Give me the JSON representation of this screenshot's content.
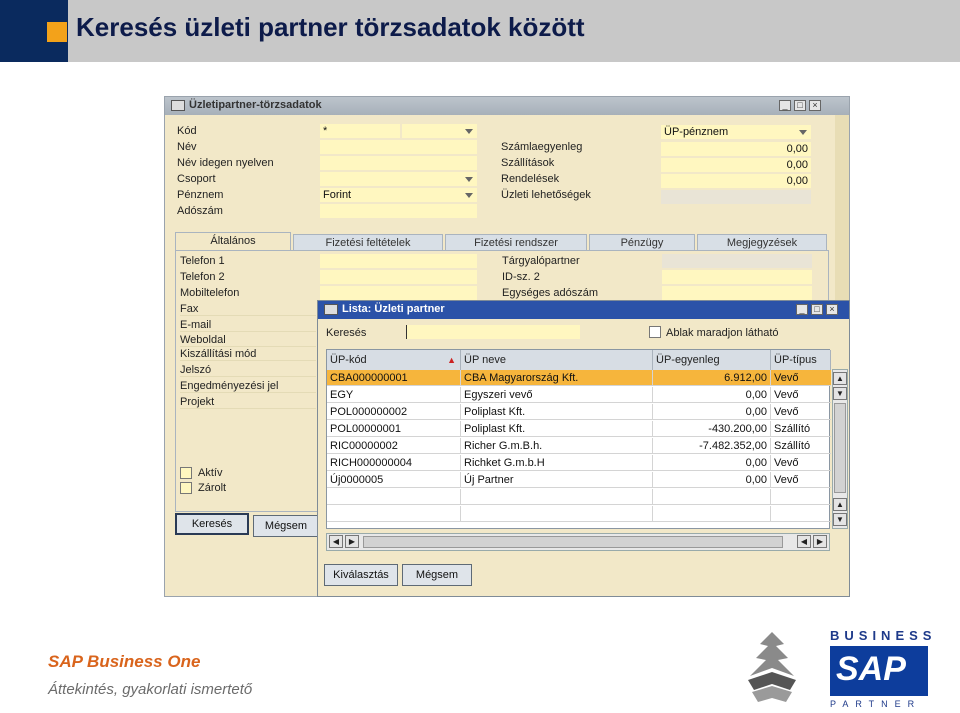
{
  "slide": {
    "title": "Keresés üzleti partner törzsadatok között",
    "footer_product": "SAP Business One",
    "footer_subtitle": "Áttekintés, gyakorlati ismertető",
    "logo_business": "BUSINESS",
    "logo_sap": "SAP",
    "logo_partner": "PARTNER"
  },
  "main_window": {
    "title": "Üzletipartner-törzsadatok",
    "labels": {
      "kod": "Kód",
      "nev": "Név",
      "nev_idegen": "Név idegen nyelven",
      "csoport": "Csoport",
      "penznem": "Pénznem",
      "adoszam": "Adószám",
      "szamlaegyenleg": "Számlaegyenleg",
      "szallitasok": "Szállítások",
      "rendelesek": "Rendelések",
      "uzleti_lehetosegek": "Üzleti lehetőségek"
    },
    "values": {
      "kod": "*",
      "penznem": "Forint",
      "up_penznem": "ÜP-pénznem",
      "szamlaegyenleg": "0,00",
      "szallitasok": "0,00",
      "rendelesek": "0,00"
    },
    "tabs": [
      "Általános",
      "Fizetési feltételek",
      "Fizetési rendszer",
      "Pénzügy",
      "Megjegyzések"
    ],
    "general_labels": [
      "Telefon 1",
      "Telefon 2",
      "Mobiltelefon",
      "Fax",
      "E-mail",
      "Weboldal",
      "Kiszállítási mód",
      "Jelszó",
      "Engedményezési jel",
      "Projekt"
    ],
    "right_labels": [
      "Tárgyalópartner",
      "ID-sz. 2",
      "Egységes adószám"
    ],
    "checkboxes": [
      "Aktív",
      "Zárolt"
    ],
    "buttons": {
      "search": "Keresés",
      "cancel": "Mégsem"
    }
  },
  "popup": {
    "title": "Lista: Üzleti partner",
    "search_label": "Keresés",
    "search_value": "",
    "checkbox_label": "Ablak maradjon látható",
    "columns": [
      "ÜP-kód",
      "ÜP neve",
      "ÜP-egyenleg",
      "ÜP-típus"
    ],
    "rows": [
      [
        "CBA000000001",
        "CBA Magyarország Kft.",
        "6.912,00",
        "Vevő"
      ],
      [
        "EGY",
        "Egyszeri vevő",
        "0,00",
        "Vevő"
      ],
      [
        "POL000000002",
        "Poliplast Kft.",
        "0,00",
        "Vevő"
      ],
      [
        "POL00000001",
        "Poliplast Kft.",
        "-430.200,00",
        "Szállító"
      ],
      [
        "RIC00000002",
        "Richer G.m.B.h.",
        "-7.482.352,00",
        "Szállító"
      ],
      [
        "RICH000000004",
        "Richket G.m.b.H",
        "0,00",
        "Vevő"
      ],
      [
        "Új0000005",
        "Új Partner",
        "0,00",
        "Vevő"
      ]
    ],
    "buttons": {
      "select": "Kiválasztás",
      "cancel": "Mégsem"
    }
  },
  "colors": {
    "field": "#fff7c0",
    "selected_row": "#f6b53c",
    "popup_title": "#2b52a8",
    "accent": "#f3a21a"
  }
}
